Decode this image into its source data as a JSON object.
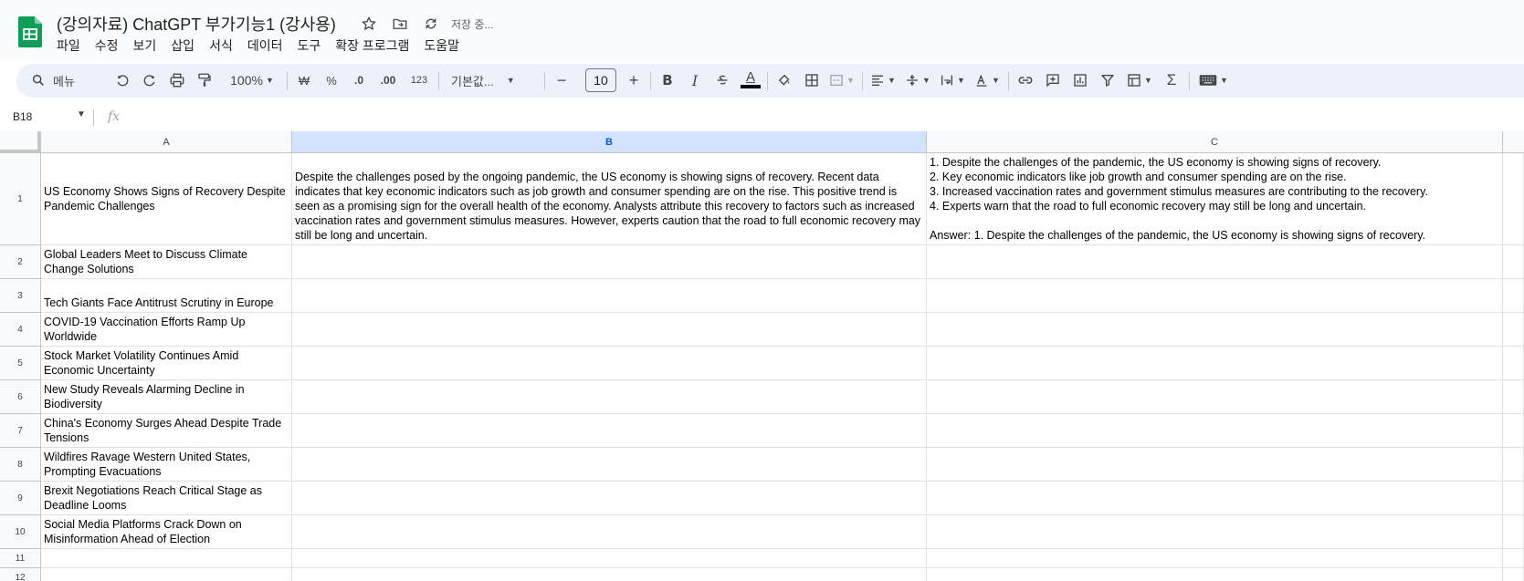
{
  "document": {
    "title": "(강의자료) ChatGPT 부가기능1 (강사용)",
    "saving_status": "저장 중..."
  },
  "menu": [
    "파일",
    "수정",
    "보기",
    "삽입",
    "서식",
    "데이터",
    "도구",
    "확장 프로그램",
    "도움말"
  ],
  "toolbar": {
    "search_label": "메뉴",
    "zoom": "100%",
    "currency": "₩",
    "percent": "%",
    "decimal_decrease": ".0",
    "decimal_increase": ".00",
    "number_format": "123",
    "font_family": "기본값...",
    "font_size": "10",
    "bold": "B",
    "italic": "I",
    "text_color_glyph": "A",
    "sum_glyph": "Σ"
  },
  "formula_bar": {
    "cell_ref": "B18",
    "fx": "fx"
  },
  "columns": [
    "A",
    "B",
    "C"
  ],
  "selected_column": "B",
  "rows": [
    {
      "num": "1",
      "a": "US Economy Shows Signs of Recovery Despite Pandemic Challenges",
      "b": "Despite the challenges posed by the ongoing pandemic, the US economy is showing signs of recovery. Recent data indicates that key economic indicators such as job growth and consumer spending are on the rise. This positive trend is seen as a promising sign for the overall health of the economy. Analysts attribute this recovery to factors such as increased vaccination rates and government stimulus measures. However, experts caution that the road to full economic recovery may still be long and uncertain.",
      "c": "1. Despite the challenges of the pandemic, the US economy is showing signs of recovery.\n2. Key economic indicators like job growth and consumer spending are on the rise.\n3. Increased vaccination rates and government stimulus measures are contributing to the recovery.\n4. Experts warn that the road to full economic recovery may still be long and uncertain.\n\nAnswer: 1. Despite the challenges of the pandemic, the US economy is showing signs of recovery."
    },
    {
      "num": "2",
      "a": "Global Leaders Meet to Discuss Climate Change Solutions",
      "b": "",
      "c": ""
    },
    {
      "num": "3",
      "a": "Tech Giants Face Antitrust Scrutiny in Europe",
      "b": "",
      "c": ""
    },
    {
      "num": "4",
      "a": "COVID-19 Vaccination Efforts Ramp Up Worldwide",
      "b": "",
      "c": ""
    },
    {
      "num": "5",
      "a": "Stock Market Volatility Continues Amid Economic Uncertainty",
      "b": "",
      "c": ""
    },
    {
      "num": "6",
      "a": "New Study Reveals Alarming Decline in Biodiversity",
      "b": "",
      "c": ""
    },
    {
      "num": "7",
      "a": "China's Economy Surges Ahead Despite Trade Tensions",
      "b": "",
      "c": ""
    },
    {
      "num": "8",
      "a": "Wildfires Ravage Western United States, Prompting Evacuations",
      "b": "",
      "c": ""
    },
    {
      "num": "9",
      "a": "Brexit Negotiations Reach Critical Stage as Deadline Looms",
      "b": "",
      "c": ""
    },
    {
      "num": "10",
      "a": "Social Media Platforms Crack Down on Misinformation Ahead of Election",
      "b": "",
      "c": ""
    },
    {
      "num": "11",
      "a": "",
      "b": "",
      "c": ""
    },
    {
      "num": "12",
      "a": "",
      "b": "",
      "c": ""
    }
  ],
  "colors": {
    "sheets_green": "#0f9d58",
    "toolbar_bg": "#edf2fa",
    "selected_header": "#d3e3fd"
  }
}
